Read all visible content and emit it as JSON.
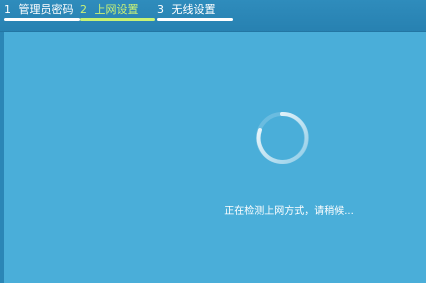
{
  "steps": [
    {
      "number": "1",
      "label": "管理员密码",
      "active": false
    },
    {
      "number": "2",
      "label": "上网设置",
      "active": true
    },
    {
      "number": "3",
      "label": "无线设置",
      "active": false
    }
  ],
  "status": {
    "message": "正在检测上网方式，请稍候..."
  },
  "colors": {
    "background": "#4aaed9",
    "topbar": "#2b86b6",
    "active_step": "#c9f276",
    "text": "#ffffff"
  },
  "icons": {
    "spinner": "loading-spinner-icon"
  }
}
